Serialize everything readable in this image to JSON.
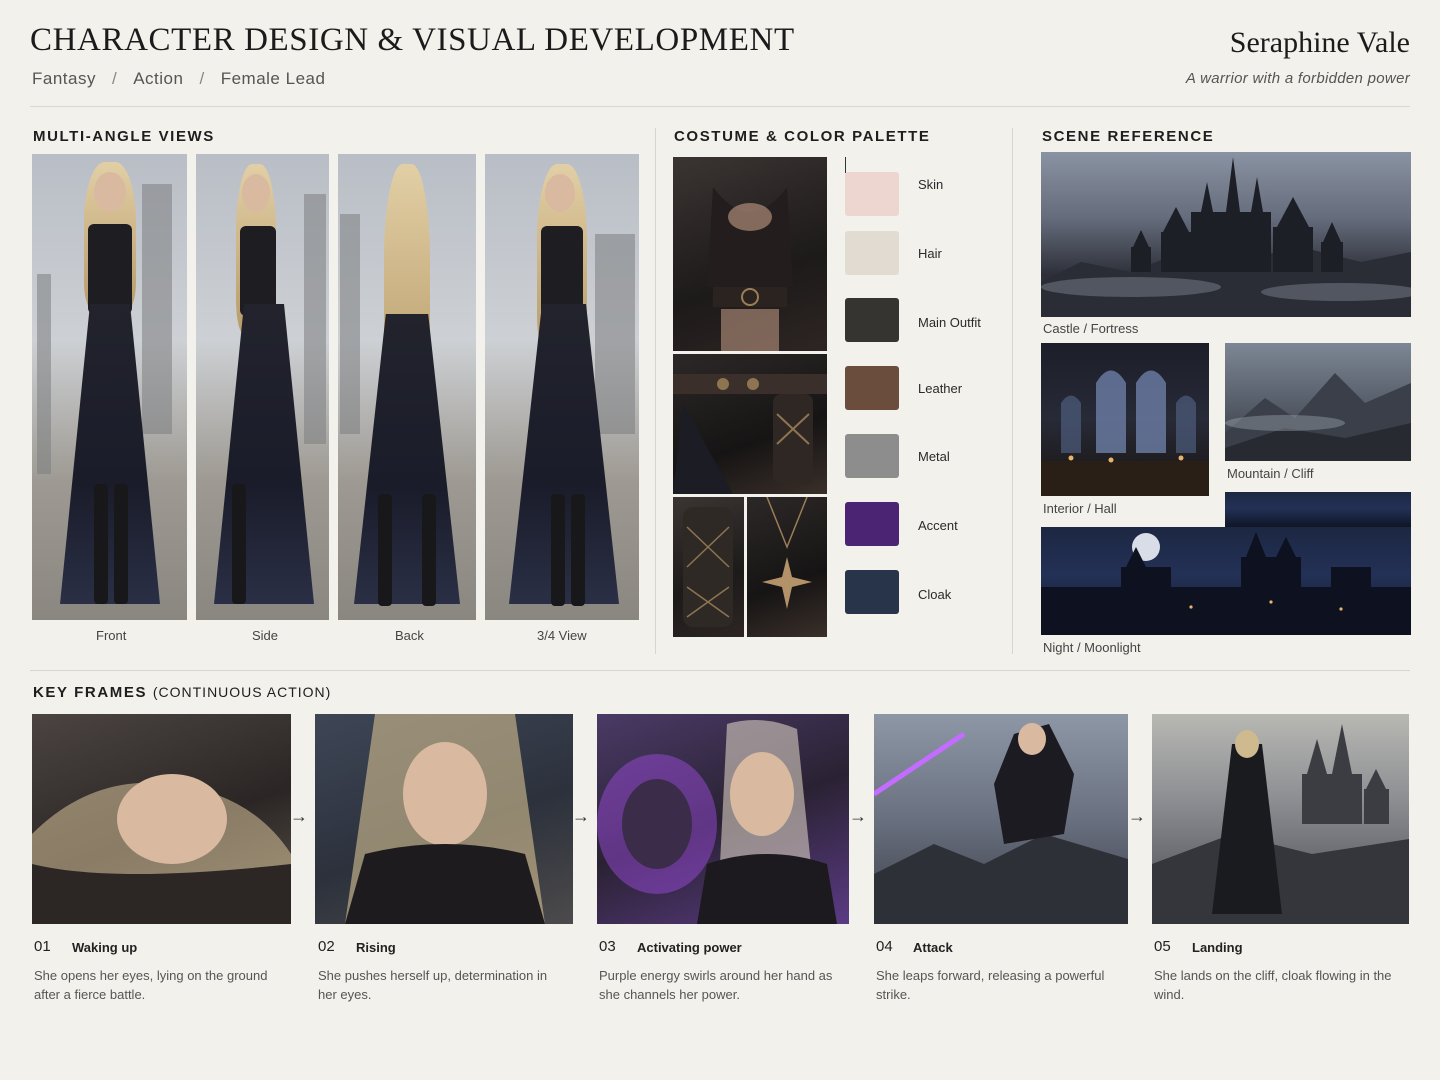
{
  "header": {
    "title": "CHARACTER DESIGN & VISUAL DEVELOPMENT",
    "genres": [
      "Fantasy",
      "Action",
      "Female Lead"
    ],
    "separator": "/",
    "character_name": "Seraphine Vale",
    "tagline": "A warrior with a forbidden power"
  },
  "multi_angle": {
    "title": "MULTI-ANGLE VIEWS",
    "views": [
      {
        "label": "Front"
      },
      {
        "label": "Side"
      },
      {
        "label": "Back"
      },
      {
        "label": "3/4 View"
      }
    ]
  },
  "costume": {
    "title": "COSTUME & COLOR PALETTE",
    "palette": [
      {
        "label": "Skin",
        "color": "#ecd6cf"
      },
      {
        "label": "Hair",
        "color": "#e2dbd1"
      },
      {
        "label": "Main Outfit",
        "color": "#363431"
      },
      {
        "label": "Leather",
        "color": "#6a4d3d"
      },
      {
        "label": "Metal",
        "color": "#8d8d8d"
      },
      {
        "label": "Accent",
        "color": "#4b2574"
      },
      {
        "label": "Cloak",
        "color": "#27344a"
      }
    ]
  },
  "scene": {
    "title": "SCENE REFERENCE",
    "items": [
      {
        "label": "Castle / Fortress"
      },
      {
        "label": "Interior / Hall"
      },
      {
        "label": "Mountain / Cliff"
      },
      {
        "label": "Night / Moonlight"
      }
    ]
  },
  "key_frames": {
    "title": "KEY FRAMES",
    "subtitle": "(CONTINUOUS ACTION)",
    "arrow": "→",
    "frames": [
      {
        "num": "01",
        "title": "Waking up",
        "desc": "She opens her eyes, lying on the ground after a fierce battle."
      },
      {
        "num": "02",
        "title": "Rising",
        "desc": "She pushes herself up, determination in her eyes."
      },
      {
        "num": "03",
        "title": "Activating power",
        "desc": "Purple energy swirls around her hand as she channels her power."
      },
      {
        "num": "04",
        "title": "Attack",
        "desc": "She leaps forward, releasing a powerful strike."
      },
      {
        "num": "05",
        "title": "Landing",
        "desc": "She lands on the cliff, cloak flowing in the wind."
      }
    ]
  }
}
